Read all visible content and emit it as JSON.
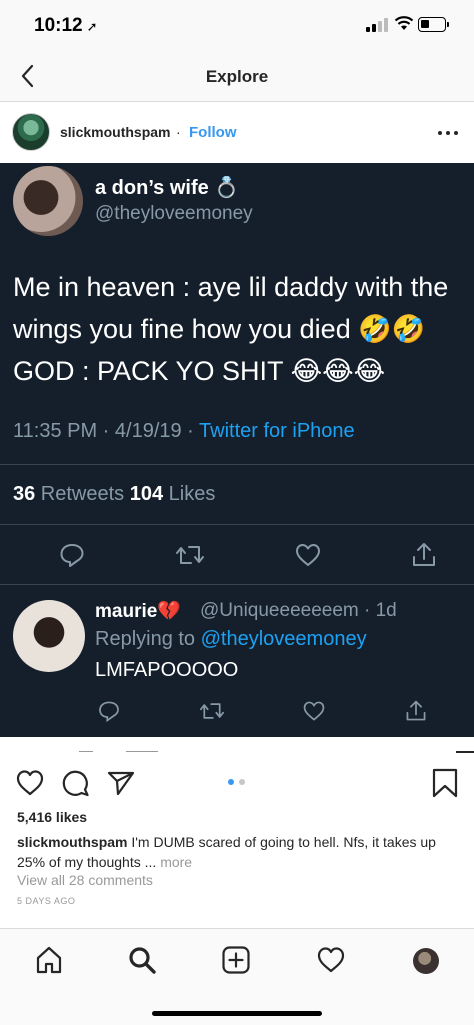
{
  "status_bar": {
    "time": "10:12",
    "location_glyph": "➚"
  },
  "nav": {
    "title": "Explore"
  },
  "post": {
    "username": "slickmouthspam",
    "separator": "·",
    "follow_label": "Follow",
    "likes": "5,416 likes",
    "caption_user": "slickmouthspam",
    "caption_text": " I'm DUMB scared of going to hell. Nfs, it takes up 25% of my thoughts ... ",
    "caption_more": "more",
    "view_comments": "View all 28 comments",
    "time_ago": "5 DAYS AGO",
    "carousel_pages": 2,
    "carousel_active": 1
  },
  "tweet": {
    "name": "a don’s wife 💍",
    "handle": "@theyloveemoney",
    "text": "Me in heaven : aye lil daddy with the wings you fine how you died 🤣🤣 GOD : PACK YO SHIT 😂😂😂",
    "time": "11:35 PM · 4/19/19 · ",
    "source": "Twitter for iPhone",
    "retweets_count": "36",
    "retweets_label": " Retweets ",
    "likes_count": "104",
    "likes_label": " Likes",
    "reply": {
      "name": "maurie💔",
      "handle": "@Uniqueeeeeeem · 1d",
      "replying_prefix": "Replying to ",
      "replying_user": "@theyloveemoney",
      "text": "LMFAPOOOOO"
    }
  },
  "colors": {
    "follow": "#3897f0",
    "tweet_bg": "#151f2b",
    "tweet_muted": "#8899a6",
    "tweet_link": "#1da1f2",
    "dot_active": "#3897f0",
    "dot_inactive": "#c7c7c7"
  },
  "icons": {
    "post_actions": [
      "heart-icon",
      "comment-icon",
      "share-icon",
      "bookmark-icon"
    ],
    "tabs": [
      "home-icon",
      "search-icon",
      "add-icon",
      "activity-icon",
      "profile-avatar"
    ]
  }
}
